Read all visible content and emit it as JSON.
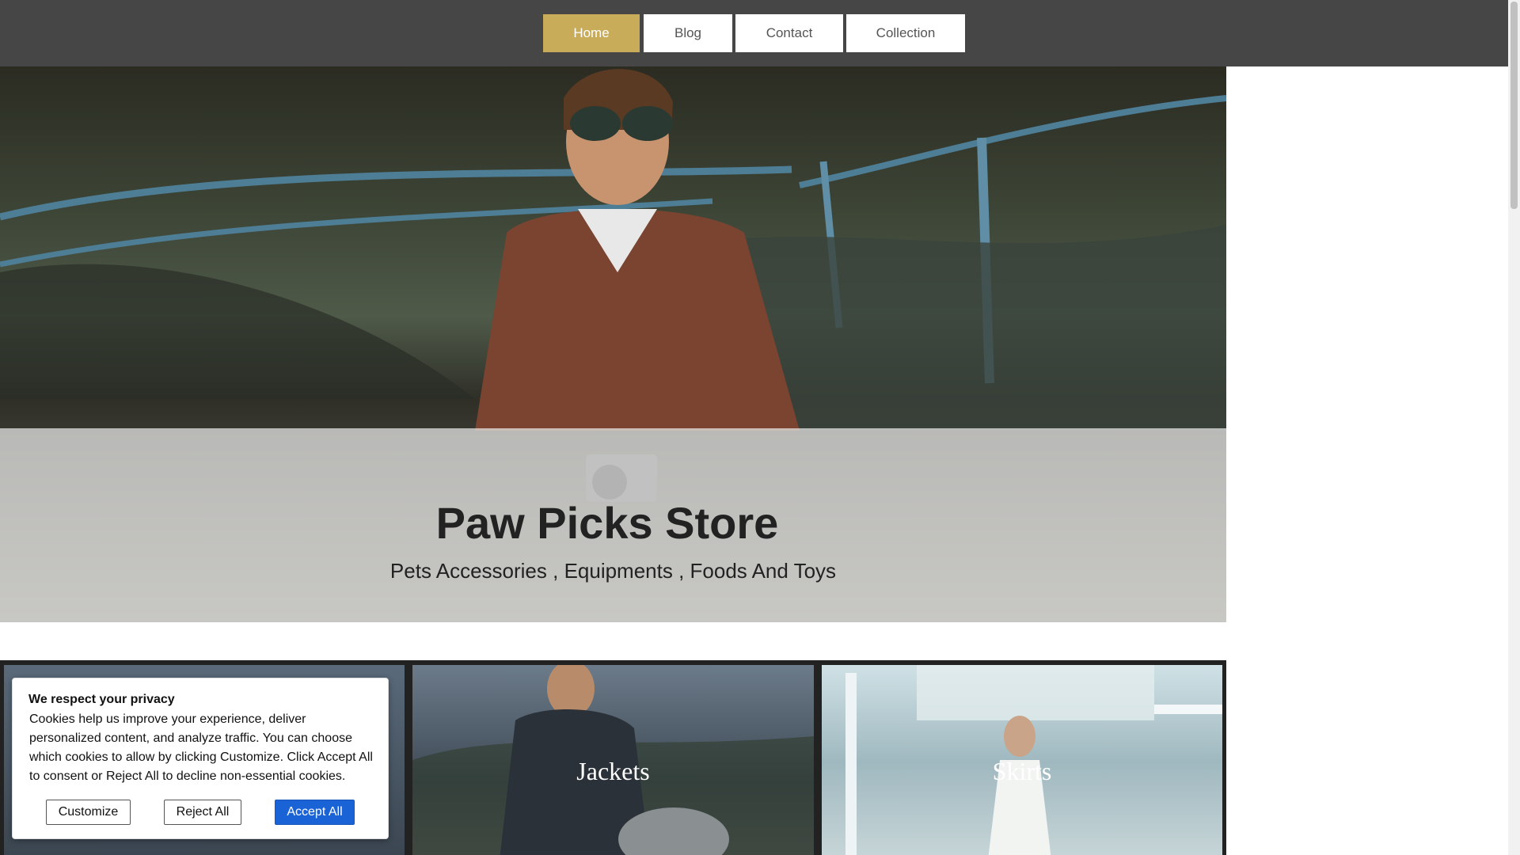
{
  "nav": {
    "items": [
      {
        "label": "Home",
        "active": true
      },
      {
        "label": "Blog",
        "active": false
      },
      {
        "label": "Contact",
        "active": false
      },
      {
        "label": "Collection",
        "active": false
      }
    ],
    "active_color": "#c9ac5a",
    "bar_color": "#464646"
  },
  "hero": {
    "title": "Paw Picks Store",
    "subtitle": "Pets Accessories , Equipments , Foods And Toys"
  },
  "categories": [
    {
      "label": ""
    },
    {
      "label": "Jackets"
    },
    {
      "label": "Skirts"
    }
  ],
  "cookie_banner": {
    "title": "We respect your privacy",
    "text": "Cookies help us improve your experience, deliver personalized content, and analyze traffic. You can choose which cookies to allow by clicking Customize. Click Accept All to consent or Reject All to decline non-essential cookies.",
    "customize_label": "Customize",
    "reject_label": "Reject All",
    "accept_label": "Accept All",
    "accept_color": "#1a63d6"
  }
}
